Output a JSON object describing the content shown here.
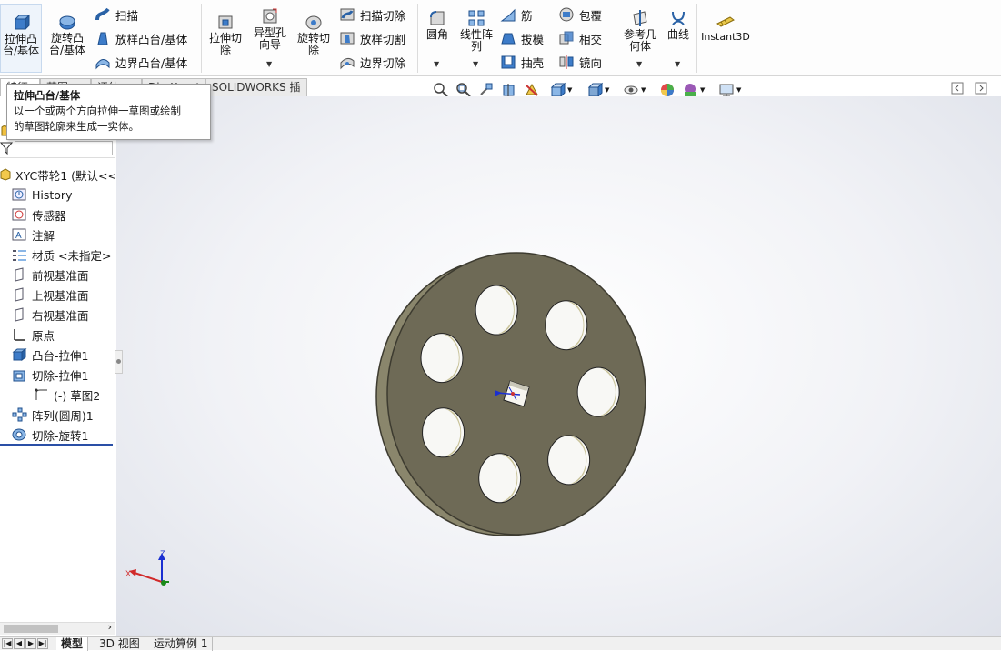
{
  "ribbon": {
    "extrude_boss": "拉伸凸\n台/基体",
    "revolve_boss": "旋转凸\n台/基体",
    "sweep": "扫描",
    "loft_boss": "放样凸台/基体",
    "boundary_boss": "边界凸台/基体",
    "extrude_cut": "拉伸切\n除",
    "hole_wizard": "异型孔\n向导",
    "revolve_cut": "旋转切\n除",
    "sweep_cut": "扫描切除",
    "loft_cut": "放样切割",
    "boundary_cut": "边界切除",
    "fillet": "圆角",
    "linear_pattern": "线性阵\n列",
    "rib": "筋",
    "draft": "拔模",
    "shell": "抽壳",
    "wrap": "包覆",
    "intersect": "相交",
    "mirror": "镜向",
    "ref_geometry": "参考几\n何体",
    "curves": "曲线",
    "instant3d": "Instant3D"
  },
  "tabs": [
    "特征",
    "草图",
    "评估",
    "DimXpert",
    "SOLIDWORKS 插件"
  ],
  "tooltip": {
    "title": "拉伸凸台/基体",
    "line1": "以一个或两个方向拉伸一草图或绘制",
    "line2": "的草图轮廓来生成一实体。"
  },
  "tree": {
    "root": "XYC带轮1 (默认<<默",
    "items": [
      {
        "label": "History",
        "icon": "history-icon"
      },
      {
        "label": "传感器",
        "icon": "sensor-icon"
      },
      {
        "label": "注解",
        "icon": "annotation-icon"
      },
      {
        "label": "材质 <未指定>",
        "icon": "material-icon"
      },
      {
        "label": "前视基准面",
        "icon": "plane-icon"
      },
      {
        "label": "上视基准面",
        "icon": "plane-icon"
      },
      {
        "label": "右视基准面",
        "icon": "plane-icon"
      },
      {
        "label": "原点",
        "icon": "origin-icon"
      },
      {
        "label": "凸台-拉伸1",
        "icon": "boss-extrude-icon"
      },
      {
        "label": "切除-拉伸1",
        "icon": "cut-extrude-icon"
      },
      {
        "label": "(-) 草图2",
        "icon": "sketch-icon"
      },
      {
        "label": "阵列(圆周)1",
        "icon": "circular-pattern-icon"
      },
      {
        "label": "切除-旋转1",
        "icon": "cut-revolve-icon"
      }
    ]
  },
  "bottom_tabs": [
    "模型",
    "3D 视图",
    "运动算例 1"
  ],
  "triad": {
    "x": "X",
    "y": "Y",
    "z": "Z"
  },
  "colors": {
    "part": "#6e6a56",
    "part_edge": "#3d3b30",
    "rim": "#8a866c"
  }
}
